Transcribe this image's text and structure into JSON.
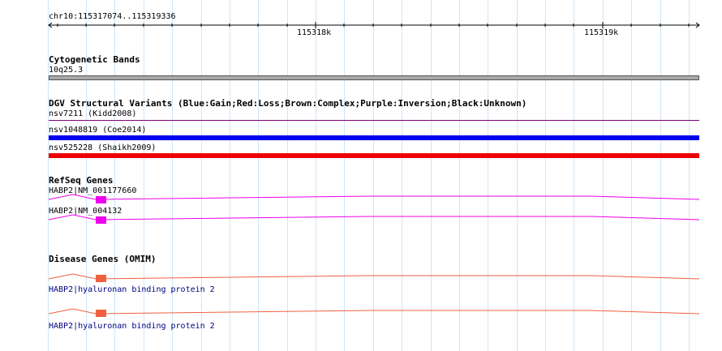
{
  "ruler": {
    "region": "chr10:115317074..115319336",
    "ticks": [
      "115318k",
      "115319k"
    ]
  },
  "tracks": {
    "cytoband": {
      "title": "Cytogenetic Bands",
      "band": "10q25.3",
      "band_color": "#a9a9a9"
    },
    "dgv": {
      "title": "DGV Structural Variants (Blue:Gain;Red:Loss;Brown:Complex;Purple:Inversion;Black:Unknown)",
      "variants": [
        {
          "label": "nsv7211 (Kidd2008)",
          "color": "#800080"
        },
        {
          "label": "nsv1048819 (Coe2014)",
          "color": "#0000ee"
        },
        {
          "label": "nsv525228 (Shaikh2009)",
          "color": "#ee0000"
        }
      ]
    },
    "refseq": {
      "title": "RefSeq Genes",
      "genes": [
        {
          "label": "HABP2|NM_001177660",
          "color": "#ee00ee"
        },
        {
          "label": "HABP2|NM_004132",
          "color": "#ee00ee"
        }
      ]
    },
    "omim": {
      "title": "Disease Genes (OMIM)",
      "genes": [
        {
          "label": "HABP2|hyaluronan binding protein 2",
          "color": "#f06040"
        },
        {
          "label": "HABP2|hyaluronan binding protein 2",
          "color": "#f06040"
        }
      ]
    }
  },
  "colors": {
    "grid": "#cfe6f4",
    "omim_label": "#000080"
  }
}
